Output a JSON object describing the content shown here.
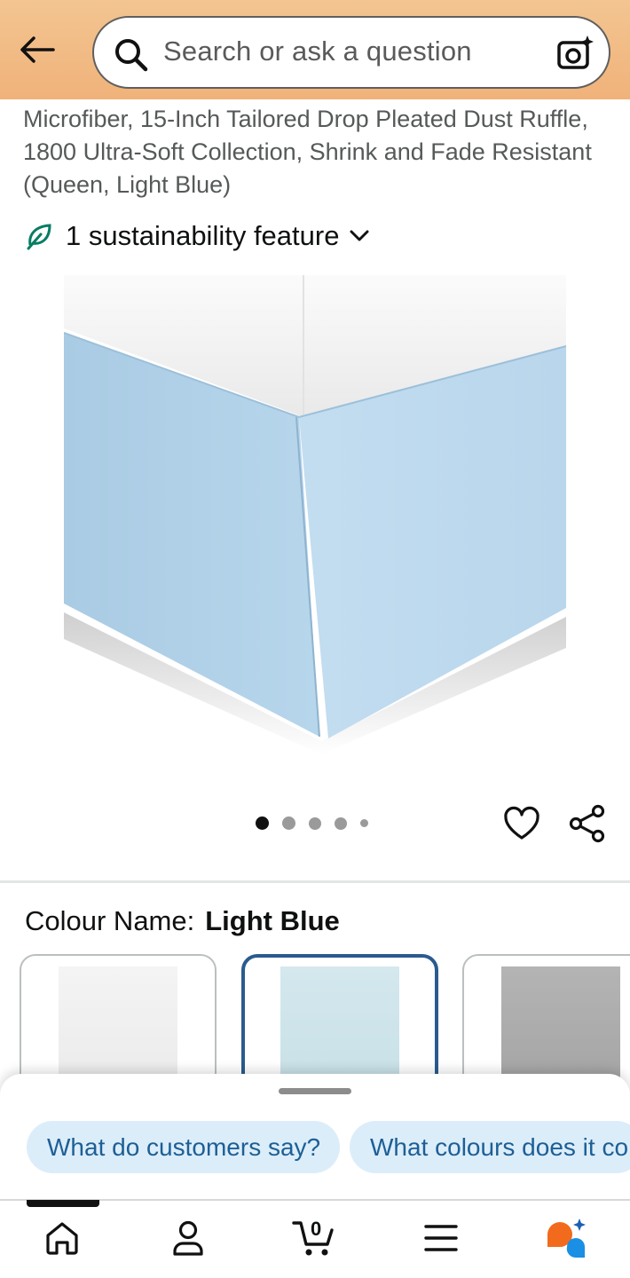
{
  "search": {
    "placeholder": "Search or ask a question"
  },
  "product": {
    "title": "Microfiber, 15-Inch Tailored Drop Pleated Dust Ruffle, 1800 Ultra-Soft Collection, Shrink and Fade Resistant (Queen, Light Blue)",
    "sustainability": "1 sustainability feature",
    "image_count": 5,
    "image_index": 1
  },
  "colour": {
    "label": "Colour Name:",
    "value": "Light Blue"
  },
  "swatches": [
    {
      "name": "white",
      "color": "#f2f2f2",
      "selected": false
    },
    {
      "name": "light-blue",
      "color": "#cfe3ea",
      "selected": true
    },
    {
      "name": "grey",
      "color": "#a9a9a9",
      "selected": false
    }
  ],
  "assistant": {
    "chips": [
      "What do customers say?",
      "What colours does it co"
    ]
  },
  "nav": {
    "cart_count": "0"
  },
  "colors": {
    "header": "#f0b27a",
    "chip_bg": "#dcedfa",
    "chip_text": "#1d5f95",
    "selected_border": "#2a5b8f"
  }
}
